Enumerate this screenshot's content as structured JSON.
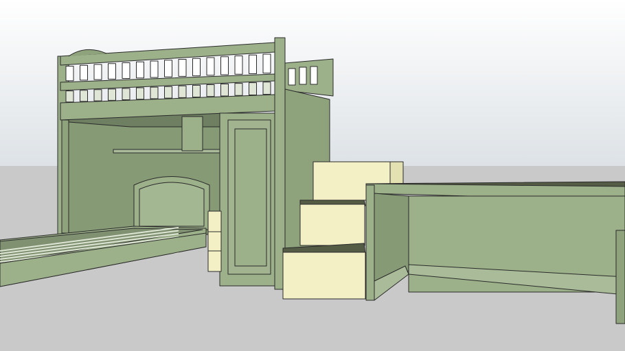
{
  "scene": {
    "colors": {
      "sky_top": "#ffffff",
      "sky_horizon": "#dde2e6",
      "ground": "#c9c9c9",
      "furniture_green": "#9cb08a",
      "furniture_green_dark": "#869a75",
      "furniture_green_shadow": "#7f9170",
      "stairs_cream": "#f2f0c4",
      "tread_dark": "#555c45",
      "edge": "#2a2a2a"
    }
  }
}
